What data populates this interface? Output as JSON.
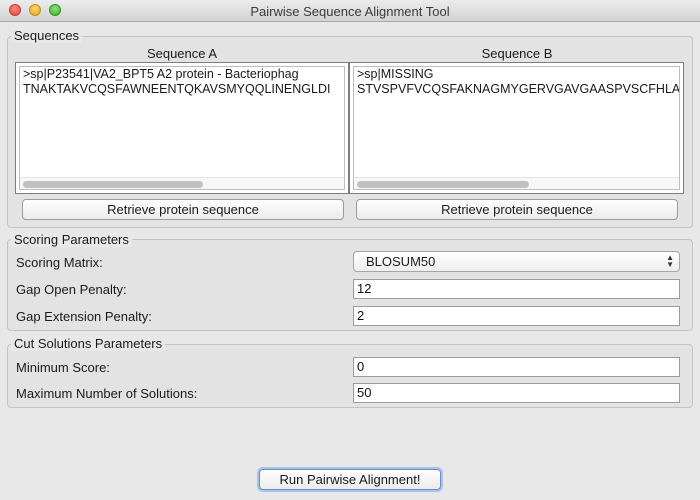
{
  "window": {
    "title": "Pairwise Sequence Alignment Tool"
  },
  "sequences": {
    "legend": "Sequences",
    "a": {
      "heading": "Sequence A",
      "lines": [
        ">sp|P23541|VA2_BPT5 A2 protein - Bacteriophag",
        "TNAKTAKVCQSFAWNEENTQKAVSMYQQLINENGLDI"
      ],
      "button": "Retrieve protein sequence"
    },
    "b": {
      "heading": "Sequence B",
      "lines": [
        ">sp|MISSING",
        "STVSPVFVCQSFAKNAGMYGERVGAVGAASPVSCFHLA"
      ],
      "button": "Retrieve protein sequence"
    }
  },
  "scoring": {
    "legend": "Scoring Parameters",
    "matrix_label": "Scoring Matrix:",
    "matrix_value": "BLOSUM50",
    "gap_open_label": "Gap Open Penalty:",
    "gap_open_value": "12",
    "gap_ext_label": "Gap Extension Penalty:",
    "gap_ext_value": "2"
  },
  "cut": {
    "legend": "Cut Solutions Parameters",
    "min_score_label": "Minimum Score:",
    "min_score_value": "0",
    "max_solutions_label": "Maximum Number of Solutions:",
    "max_solutions_value": "50"
  },
  "run_button": "Run Pairwise Alignment!",
  "icons": {
    "close": "close-icon",
    "minimize": "minimize-icon",
    "maximize": "maximize-icon",
    "select_arrows": "updown-arrows-icon"
  }
}
